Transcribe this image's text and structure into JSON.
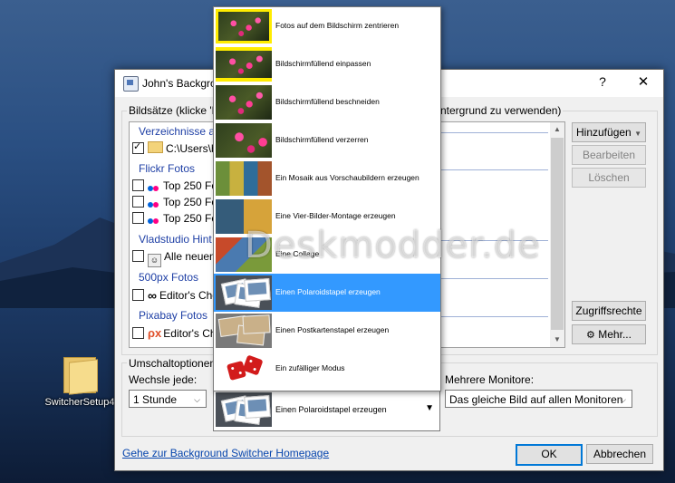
{
  "desktop": {
    "icon_label": "SwitcherSetup4",
    "watermark": "Deskmodder.de"
  },
  "window": {
    "title": "John's Backgro",
    "help": "?",
    "close": "✕"
  },
  "sets": {
    "group_label_left": "Bildsätze (klicke 'H",
    "group_label_right": "ntergrund zu verwenden)",
    "categories": [
      {
        "name": "Verzeichnisse au"
      },
      {
        "name": "Flickr Fotos"
      },
      {
        "name": "Vladstudio Hint"
      },
      {
        "name": "500px Fotos"
      },
      {
        "name": "Pixabay Fotos"
      }
    ],
    "rows": [
      {
        "label": "C:\\Users\\br",
        "checked": true
      },
      {
        "label": "Top 250 Fot",
        "checked": false
      },
      {
        "label": "Top 250 Fot",
        "checked": false
      },
      {
        "label": "Top 250 Fot",
        "checked": false
      },
      {
        "label": "Alle neuen I",
        "checked": false
      },
      {
        "label": "Editor's Cho",
        "checked": false
      },
      {
        "label": "Editor's Cho",
        "checked": false
      }
    ]
  },
  "buttons": {
    "add": "Hinzufügen",
    "edit": "Bearbeiten",
    "delete": "Löschen",
    "rights": "Zugriffsrechte",
    "more": "Mehr...",
    "ok": "OK",
    "cancel": "Abbrechen"
  },
  "switch_options": {
    "group_label": "Umschaltoptionen",
    "interval_label": "Wechsle jede:",
    "interval_value": "1 Stunde",
    "monitors_label": "Mehrere Monitore:",
    "monitors_value": "Das gleiche Bild auf allen Monitoren",
    "mode_selected": "Einen Polaroidstapel erzeugen"
  },
  "mode_options": [
    {
      "label": "Fotos auf dem Bildschirm zentrieren",
      "thumb": "flowers-center"
    },
    {
      "label": "Bildschirmfüllend einpassen",
      "thumb": "flowers-fit"
    },
    {
      "label": "Bildschirmfüllend beschneiden",
      "thumb": "flowers-crop"
    },
    {
      "label": "Bildschirmfüllend verzerren",
      "thumb": "flowers-stretch"
    },
    {
      "label": "Ein Mosaik aus Vorschaubildern erzeugen",
      "thumb": "mosaic"
    },
    {
      "label": "Eine Vier-Bilder-Montage erzeugen",
      "thumb": "four-montage"
    },
    {
      "label": "Eine Collage",
      "thumb": "collage"
    },
    {
      "label": "Einen Polaroidstapel erzeugen",
      "thumb": "polaroid",
      "selected": true
    },
    {
      "label": "Einen Postkartenstapel erzeugen",
      "thumb": "postcards"
    },
    {
      "label": "Ein zufälliger Modus",
      "thumb": "dice"
    }
  ],
  "homepage_link": "Gehe zur Background Switcher Homepage",
  "colors": {
    "selection": "#3399ff",
    "link": "#0645ad",
    "category": "#1e3fa5"
  }
}
